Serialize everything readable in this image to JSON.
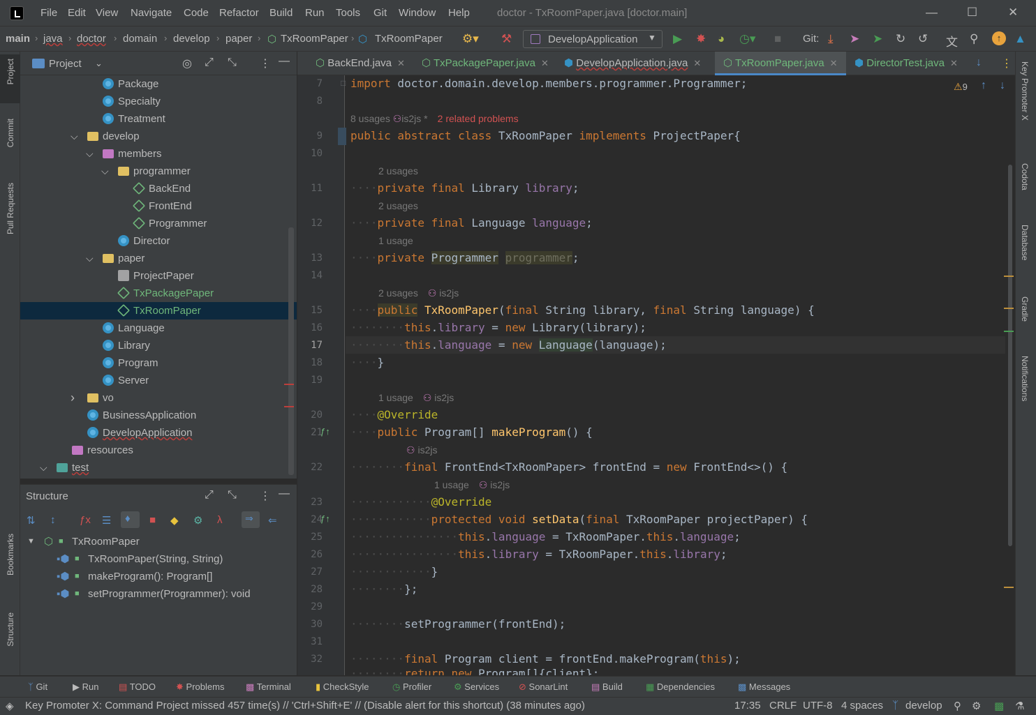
{
  "menu": [
    "File",
    "Edit",
    "View",
    "Navigate",
    "Code",
    "Refactor",
    "Build",
    "Run",
    "Tools",
    "Git",
    "Window",
    "Help"
  ],
  "window_title": "doctor - TxRoomPaper.java [doctor.main]",
  "breadcrumb": [
    "main",
    "java",
    "doctor",
    "domain",
    "develop",
    "paper",
    "TxRoomPaper",
    "TxRoomPaper"
  ],
  "run_config": "DevelopApplication",
  "git_label": "Git:",
  "project_panel": {
    "title": "Project",
    "tree": [
      {
        "label": "Package",
        "indent": 3,
        "icon": "class-icon"
      },
      {
        "label": "Specialty",
        "indent": 3,
        "icon": "class-icon"
      },
      {
        "label": "Treatment",
        "indent": 3,
        "icon": "class-icon"
      },
      {
        "label": "develop",
        "indent": 2,
        "icon": "folder-icon",
        "arrow": "v"
      },
      {
        "label": "members",
        "indent": 3,
        "icon": "package-icon",
        "arrow": "v"
      },
      {
        "label": "programmer",
        "indent": 4,
        "icon": "folder-icon",
        "arrow": "v"
      },
      {
        "label": "BackEnd",
        "indent": 5,
        "icon": "abstract-class-icon"
      },
      {
        "label": "FrontEnd",
        "indent": 5,
        "icon": "abstract-class-icon"
      },
      {
        "label": "Programmer",
        "indent": 5,
        "icon": "abstract-class-icon"
      },
      {
        "label": "Director",
        "indent": 4,
        "icon": "class-icon"
      },
      {
        "label": "paper",
        "indent": 3,
        "icon": "folder-icon",
        "arrow": "v"
      },
      {
        "label": "ProjectPaper",
        "indent": 4,
        "icon": "interface-icon"
      },
      {
        "label": "TxPackagePaper",
        "indent": 4,
        "icon": "abstract-class-icon",
        "color": "#6fb77b"
      },
      {
        "label": "TxRoomPaper",
        "indent": 4,
        "icon": "abstract-class-icon",
        "color": "#6fb77b",
        "selected": true
      },
      {
        "label": "Language",
        "indent": 3,
        "icon": "class-icon"
      },
      {
        "label": "Library",
        "indent": 3,
        "icon": "class-icon"
      },
      {
        "label": "Program",
        "indent": 3,
        "icon": "class-icon"
      },
      {
        "label": "Server",
        "indent": 3,
        "icon": "class-icon"
      },
      {
        "label": "vo",
        "indent": 2,
        "icon": "folder-icon",
        "arrow": ">"
      },
      {
        "label": "BusinessApplication",
        "indent": 2,
        "icon": "class-icon"
      },
      {
        "label": "DevelopApplication",
        "indent": 2,
        "icon": "class-icon",
        "underline": true
      },
      {
        "label": "resources",
        "indent": 1,
        "icon": "resources-folder-icon"
      },
      {
        "label": "test",
        "indent": 0,
        "icon": "test-folder-icon",
        "arrow": "v",
        "underline": true
      }
    ]
  },
  "structure_panel": {
    "title": "Structure",
    "root": "TxRoomPaper",
    "members": [
      "TxRoomPaper(String, String)",
      "makeProgram(): Program[]",
      "setProgrammer(Programmer): void"
    ]
  },
  "tabs": [
    {
      "label": "BackEnd.java",
      "active": false
    },
    {
      "label": "TxPackagePaper.java",
      "active": false
    },
    {
      "label": "DevelopApplication.java",
      "active": false
    },
    {
      "label": "TxRoomPaper.java",
      "active": true
    },
    {
      "label": "DirectorTest.java",
      "active": false
    }
  ],
  "warnings_count": "9",
  "hints": {
    "h8": "8 usages",
    "h8_author": "is2js *",
    "h8_problems": "2 related problems",
    "h2a": "2 usages",
    "h2b": "2 usages",
    "h1a": "1 usage",
    "h2c": "2 usages",
    "h2c_author": "is2js",
    "h1b": "1 usage",
    "h1b_author": "is2js",
    "h_author_only": "is2js",
    "h1c": "1 usage",
    "h1c_author": "is2js"
  },
  "line_numbers": [
    "7",
    "8",
    "9",
    "10",
    "11",
    "12",
    "13",
    "14",
    "15",
    "16",
    "17",
    "18",
    "19",
    "20",
    "21",
    "22",
    "23",
    "24",
    "25",
    "26",
    "27",
    "28",
    "29",
    "30",
    "31",
    "32"
  ],
  "status_tools": [
    "Git",
    "Run",
    "TODO",
    "Problems",
    "Terminal",
    "CheckStyle",
    "Profiler",
    "Services",
    "SonarLint",
    "Build",
    "Dependencies",
    "Messages"
  ],
  "status_message": "Key Promoter X: Command Project missed 457 time(s) // 'Ctrl+Shift+E' // (Disable alert for this shortcut) (38 minutes ago)",
  "status_right": {
    "position": "17:35",
    "line_sep": "CRLF",
    "encoding": "UTF-8",
    "indent": "4 spaces",
    "branch": "develop"
  },
  "left_stripe": [
    "Project",
    "Commit",
    "Pull Requests",
    "Bookmarks",
    "Structure"
  ],
  "right_stripe": [
    "Key Promoter X",
    "Codota",
    "Database",
    "Gradle",
    "Notifications"
  ],
  "colors": {
    "keyword": "#cc7832",
    "field": "#9876aa",
    "method": "#ffc66d",
    "annotation": "#bbb529",
    "text": "#a9b7c6",
    "selection": "#0d293e"
  }
}
